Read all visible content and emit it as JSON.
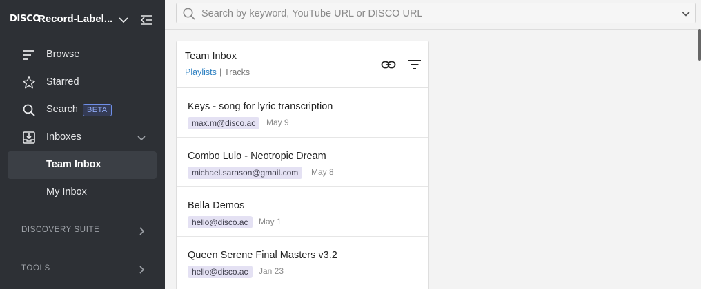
{
  "sidebar": {
    "logo": "DISCO",
    "org_name": "Record-Label...",
    "nav": [
      {
        "label": "Browse",
        "icon": "browse-icon"
      },
      {
        "label": "Starred",
        "icon": "star-icon"
      },
      {
        "label": "Search",
        "icon": "search-icon",
        "badge": "BETA"
      },
      {
        "label": "Inboxes",
        "icon": "inbox-icon"
      }
    ],
    "inbox_items": [
      {
        "label": "Team Inbox",
        "active": true
      },
      {
        "label": "My Inbox",
        "active": false
      }
    ],
    "sections": [
      {
        "label": "DISCOVERY SUITE"
      },
      {
        "label": "TOOLS"
      }
    ]
  },
  "search": {
    "placeholder": "Search by keyword, YouTube URL or DISCO URL"
  },
  "panel": {
    "title": "Team Inbox",
    "tabs": [
      "Playlists",
      "Tracks"
    ],
    "tab_separator": "|",
    "rows": [
      {
        "title": "Keys - song for lyric transcription",
        "sender": "max.m@disco.ac",
        "date": "May 9"
      },
      {
        "title": "Combo Lulo - Neotropic Dream",
        "sender": "michael.sarason@gmail.com",
        "date": "May 8"
      },
      {
        "title": "Bella Demos",
        "sender": "hello@disco.ac",
        "date": "May 1"
      },
      {
        "title": "Queen Serene Final Masters v3.2",
        "sender": "hello@disco.ac",
        "date": "Jan 23"
      }
    ]
  },
  "colors": {
    "sidebar_bg": "#2d3035",
    "active_item_bg": "#3b3f45",
    "accent_link": "#2b7fc1",
    "chip_bg": "#e4e1f3",
    "beta_border": "#6f8fe8"
  }
}
